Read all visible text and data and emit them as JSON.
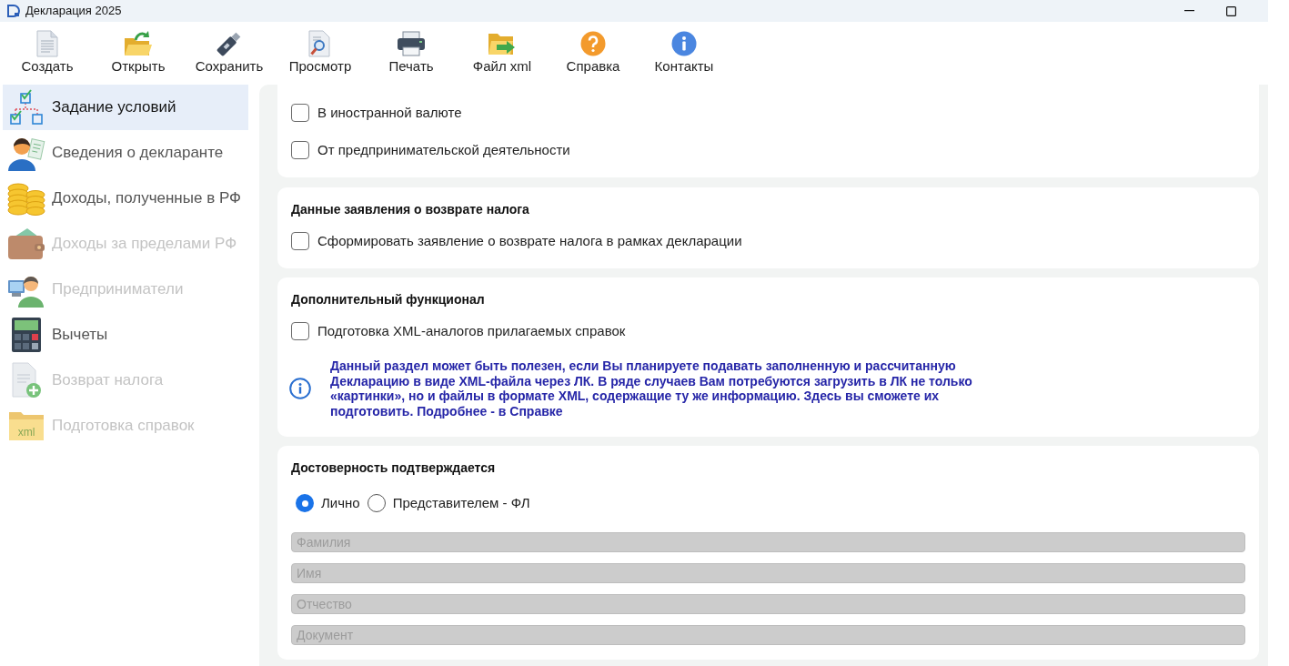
{
  "window": {
    "title": "Декларация 2025"
  },
  "toolbar": [
    {
      "label": "Создать"
    },
    {
      "label": "Открыть"
    },
    {
      "label": "Сохранить"
    },
    {
      "label": "Просмотр"
    },
    {
      "label": "Печать"
    },
    {
      "label": "Файл xml"
    },
    {
      "label": "Справка"
    },
    {
      "label": "Контакты"
    }
  ],
  "sidebar": {
    "items": [
      {
        "label": "Задание условий",
        "selected": true,
        "disabled": false
      },
      {
        "label": "Сведения о декларанте",
        "selected": false,
        "disabled": false
      },
      {
        "label": "Доходы, полученные в РФ",
        "selected": false,
        "disabled": false
      },
      {
        "label": "Доходы за пределами РФ",
        "selected": false,
        "disabled": true
      },
      {
        "label": "Предприниматели",
        "selected": false,
        "disabled": true
      },
      {
        "label": "Вычеты",
        "selected": false,
        "disabled": false
      },
      {
        "label": "Возврат налога",
        "selected": false,
        "disabled": true
      },
      {
        "label": "Подготовка справок",
        "selected": false,
        "disabled": true,
        "icon_text": "xml"
      }
    ]
  },
  "sections": [
    {
      "options": [
        {
          "label": "В иностранной валюте",
          "checked": false
        },
        {
          "label": "От предпринимательской деятельности",
          "checked": false
        }
      ]
    },
    {
      "title": "Данные заявления о возврате налога",
      "options": [
        {
          "label": "Сформировать заявление о возврате налога в рамках декларации",
          "checked": false
        }
      ]
    },
    {
      "title": "Дополнительный функционал",
      "options": [
        {
          "label": "Подготовка XML-аналогов прилагаемых справок",
          "checked": false
        }
      ],
      "note": "Данный раздел может быть полезен, если Вы планируете подавать заполненную и рассчитанную Декларацию в виде XML-файла через ЛК. В ряде случаев Вам потребуются загрузить в ЛК не только «картинки», но и файлы в формате XML, содержащие ту же информацию. Здесь вы сможете их подготовить. Подробнее - в Справке"
    }
  ],
  "confirmation": {
    "title": "Достоверность подтверждается",
    "choices": [
      {
        "label": "Лично",
        "selected": true
      },
      {
        "label": "Представителем - ФЛ",
        "selected": false
      }
    ],
    "fields": [
      {
        "placeholder": "Фамилия",
        "disabled": true
      },
      {
        "placeholder": "Имя",
        "disabled": true
      },
      {
        "placeholder": "Отчество",
        "disabled": true
      },
      {
        "placeholder": "Документ",
        "disabled": true
      }
    ]
  }
}
